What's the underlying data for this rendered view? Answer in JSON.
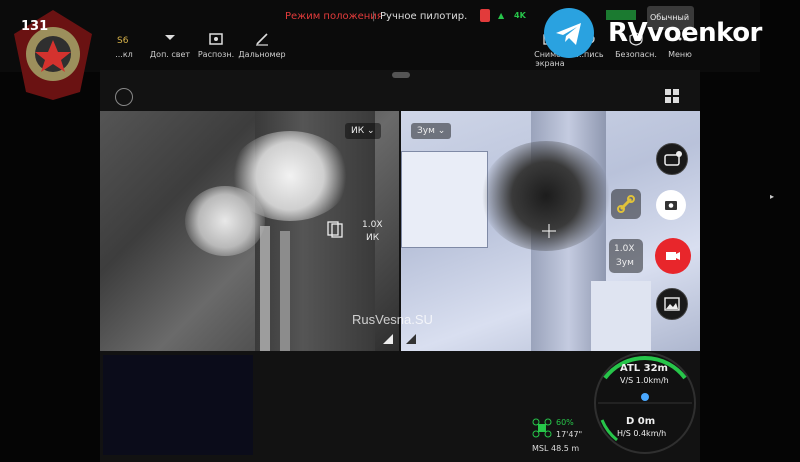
{
  "header": {
    "mode_label": "Режим положения",
    "pilot_label": "Ручное пилотир.",
    "signal_label": "4K",
    "view_mode": "Обычный",
    "tools": [
      {
        "label": "...кл",
        "icon": "gear-icon"
      },
      {
        "label": "Доп. свет",
        "icon": "light-icon"
      },
      {
        "label": "Распозн.",
        "icon": "recognize-icon"
      },
      {
        "label": "Дальномер",
        "icon": "rangefinder-icon"
      }
    ],
    "right_tools": [
      {
        "label": "Снимок экрана",
        "icon": "screenshot-icon"
      },
      {
        "label": "...пись",
        "icon": "record-screen-icon"
      },
      {
        "label": "Безопасн.",
        "icon": "safety-icon"
      },
      {
        "label": "Меню",
        "icon": "menu-icon"
      }
    ]
  },
  "watermark": {
    "channel": "RVvoenkor",
    "site": "RusVesna.SU",
    "badge_number": "131"
  },
  "left_view": {
    "lens_select": "ИК",
    "zoom": "1.0X",
    "zoom_mode": "ИК"
  },
  "right_view": {
    "lens_select": "Зум",
    "zoom": "1.0X",
    "zoom_mode": "Зум"
  },
  "telemetry": {
    "atl": "ATL 32m",
    "vs": "V/S 1.0km/h",
    "distance": "D  0m",
    "hs": "H/S 0.4km/h",
    "battery": "60%",
    "time": "17'47\"",
    "msl": "MSL 48.5 m"
  },
  "colors": {
    "record_red": "#e8262b",
    "accent_green": "#27c54a",
    "mode_red": "#e23b3b",
    "telegram_blue": "#2aa2e0"
  }
}
